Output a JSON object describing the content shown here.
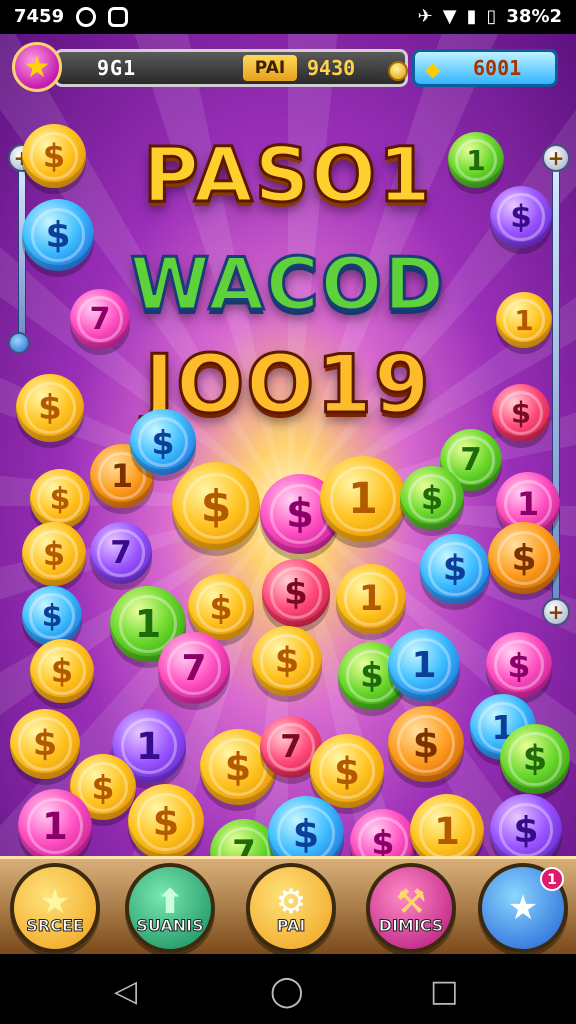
{
  "status_bar": {
    "time": "7459",
    "battery_text": "38%2"
  },
  "hud": {
    "left_value": "9G1",
    "chip_label": "PAI",
    "chip_value": "9430",
    "right_value": "6001"
  },
  "title": {
    "line1": "PASO1",
    "line2": "WACOD",
    "line3": "JOO19"
  },
  "coins": [
    {
      "color": "gold",
      "symbol": "$"
    },
    {
      "color": "green",
      "symbol": "$"
    },
    {
      "color": "blue",
      "symbol": "$"
    },
    {
      "color": "pink",
      "symbol": "1"
    },
    {
      "color": "gold",
      "symbol": "$"
    },
    {
      "color": "red",
      "symbol": "7"
    },
    {
      "color": "purple",
      "symbol": "1"
    },
    {
      "color": "gold",
      "symbol": "$"
    },
    {
      "color": "green",
      "symbol": "$"
    },
    {
      "color": "pink",
      "symbol": "$"
    },
    {
      "color": "blue",
      "symbol": "$"
    },
    {
      "color": "gold",
      "symbol": "1"
    }
  ],
  "bottom_nav": [
    {
      "label": "SRCEE",
      "icon": "star-icon"
    },
    {
      "label": "SUANIS",
      "icon": "arrow-up-icon"
    },
    {
      "label": "PAI",
      "icon": "gear-icon"
    },
    {
      "label": "DIMICS",
      "icon": "hammer-icon"
    },
    {
      "label": "",
      "icon": "star-icon",
      "badge": "1"
    }
  ],
  "colors": {
    "background_primary": "#9a2fb8",
    "gold": "#ffc21f",
    "title_green": "#5fd13a"
  }
}
